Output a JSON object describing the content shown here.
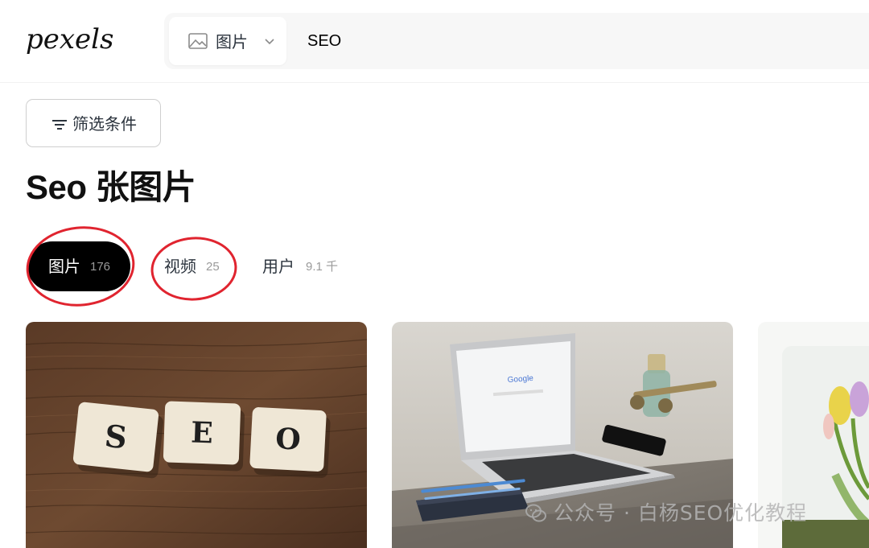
{
  "brand": {
    "logo_text": "pexels"
  },
  "search": {
    "type_label": "图片",
    "query": "SEO"
  },
  "filter": {
    "label": "筛选条件"
  },
  "page_title": "Seo 张图片",
  "tabs": [
    {
      "label": "图片",
      "count": "176",
      "active": true
    },
    {
      "label": "视频",
      "count": "25",
      "active": false
    },
    {
      "label": "用户",
      "count": "9.1 千",
      "active": false
    }
  ],
  "photos": [
    {
      "content": "SEO scrabble tiles on wooden table"
    },
    {
      "content": "Laptop showing Google on desk"
    },
    {
      "content": "Tulips (partially visible)"
    }
  ],
  "photo_1_tiles": [
    "S",
    "E",
    "O"
  ],
  "laptop_screen_text": "Google",
  "watermark": {
    "text": "公众号 · 白杨SEO优化教程",
    "icon": "wechat-icon"
  },
  "colors": {
    "active_tab_bg": "#000000",
    "annotation_circle": "#e0242f",
    "search_bg": "#f7f7f7"
  }
}
